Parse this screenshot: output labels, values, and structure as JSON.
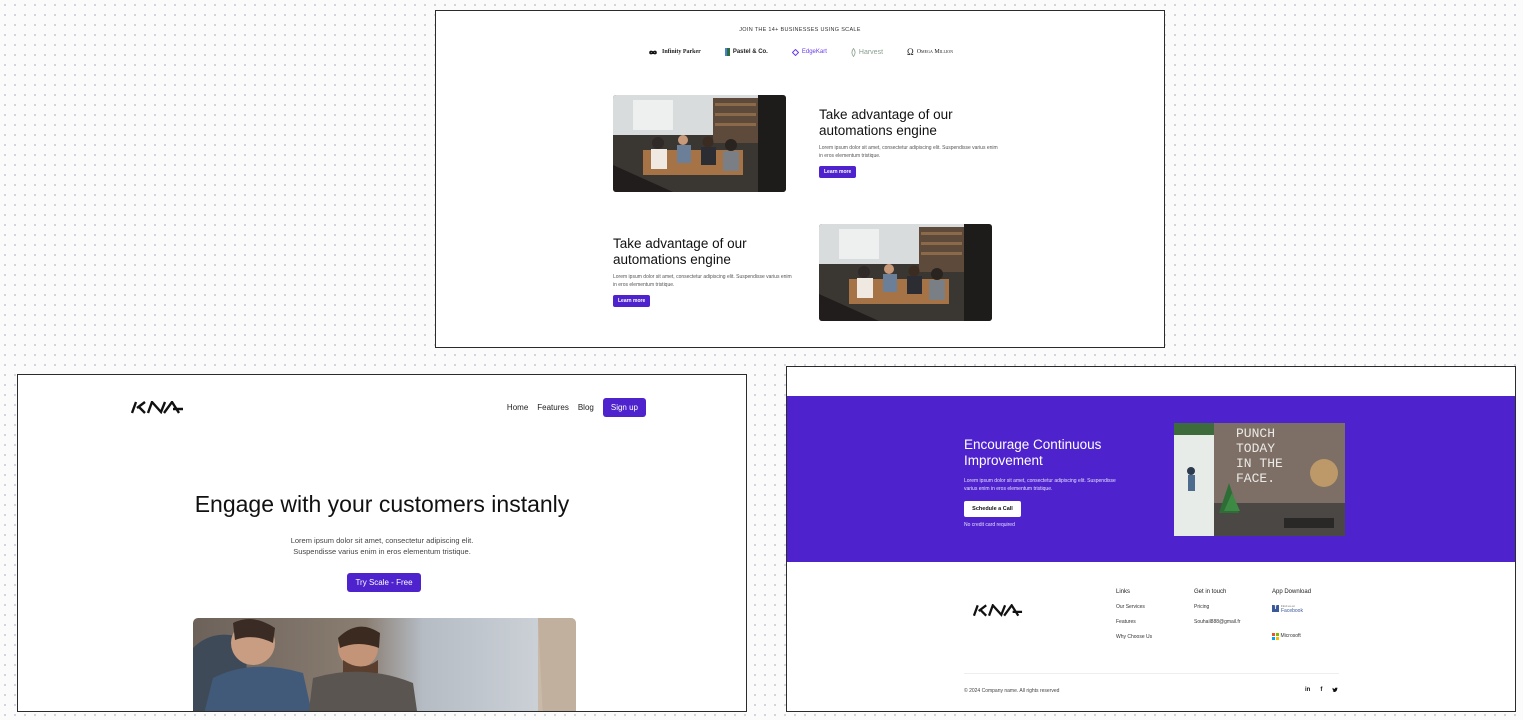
{
  "top_section": {
    "logos_heading": "JOIN THE 14+ BUSINESSES USING SCALE",
    "logos": [
      {
        "name": "Infinity Parker",
        "icon": "infinity-icon"
      },
      {
        "name": "Pastel & Co.",
        "icon": "book-icon"
      },
      {
        "name": "EdgeKart",
        "icon": "diamond-icon"
      },
      {
        "name": "Harvest",
        "icon": "leaf-icon"
      },
      {
        "name": "Omega Million",
        "icon": "omega-icon"
      }
    ],
    "features": [
      {
        "title": "Take advantage of our automations engine",
        "body": "Lorem ipsum dolor sit amet, consectetur adipiscing elit. Suspendisse varius enim in eros elementum tristique.",
        "button": "Learn more"
      },
      {
        "title": "Take advantage of our automations engine",
        "body": "Lorem ipsum dolor sit amet, consectetur adipiscing elit. Suspendisse varius enim in eros elementum tristique.",
        "button": "Learn more"
      }
    ]
  },
  "hero_section": {
    "nav": {
      "home": "Home",
      "features": "Features",
      "blog": "Blog",
      "signup": "Sign up"
    },
    "title": "Engage with your customers instanly",
    "subtitle_line1": "Lorem ipsum dolor sit amet, consectetur adipiscing elit.",
    "subtitle_line2": "Suspendisse varius enim in eros elementum tristique.",
    "cta": "Try Scale - Free"
  },
  "cta_section": {
    "title": "Encourage Continuous Improvement",
    "body": "Lorem ipsum dolor sit amet, consectetur adipiscing elit. Suspendisse varius enim in eros elementum tristique.",
    "button": "Schedule a Call",
    "note": "No credit card required",
    "image_text": [
      "PUNCH",
      "TODAY",
      "IN THE",
      "FACE."
    ]
  },
  "footer": {
    "links_title": "Links",
    "links": [
      "Our Services",
      "Features",
      "Why Choose Us"
    ],
    "contact_title": "Get in touch",
    "contact": [
      "Pricing",
      "Souhail888@gmail.fr"
    ],
    "app_title": "App Download",
    "app_facebook_small": "Find us on",
    "app_facebook": "Facebook",
    "app_microsoft": "Microsoft",
    "copyright": "© 2024 Company name. All rights reserved",
    "socials": [
      "in",
      "f",
      "t"
    ]
  },
  "colors": {
    "accent": "#4e22cc",
    "background": "#fbfbfc"
  }
}
